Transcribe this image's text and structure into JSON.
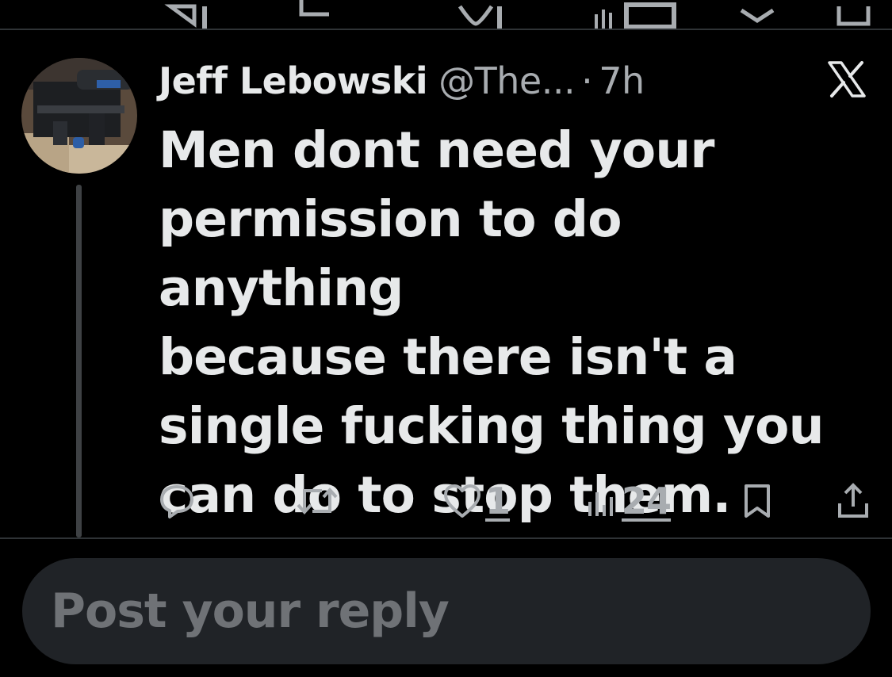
{
  "tweet": {
    "display_name": "Jeff Lebowski",
    "handle": "@The...",
    "separator": "·",
    "time": "7h",
    "text": "Men dont need your\npermission to do anything\nbecause there isn't a\nsingle fucking thing you\ncan do to stop them.",
    "actions": {
      "reply_icon": "reply-icon",
      "repost_icon": "repost-icon",
      "like_icon": "heart-icon",
      "like_count": "1",
      "views_icon": "views-icon",
      "views_count": "24",
      "bookmark_icon": "bookmark-icon",
      "share_icon": "share-icon"
    },
    "close_icon": "x-logo-icon"
  },
  "reply": {
    "placeholder": "Post your reply"
  },
  "colors": {
    "background": "#000000",
    "text_primary": "#e7e9ea",
    "text_secondary": "#a8acb0",
    "divider": "#2f3336",
    "reply_box": "#202327",
    "placeholder": "#6f7276"
  }
}
